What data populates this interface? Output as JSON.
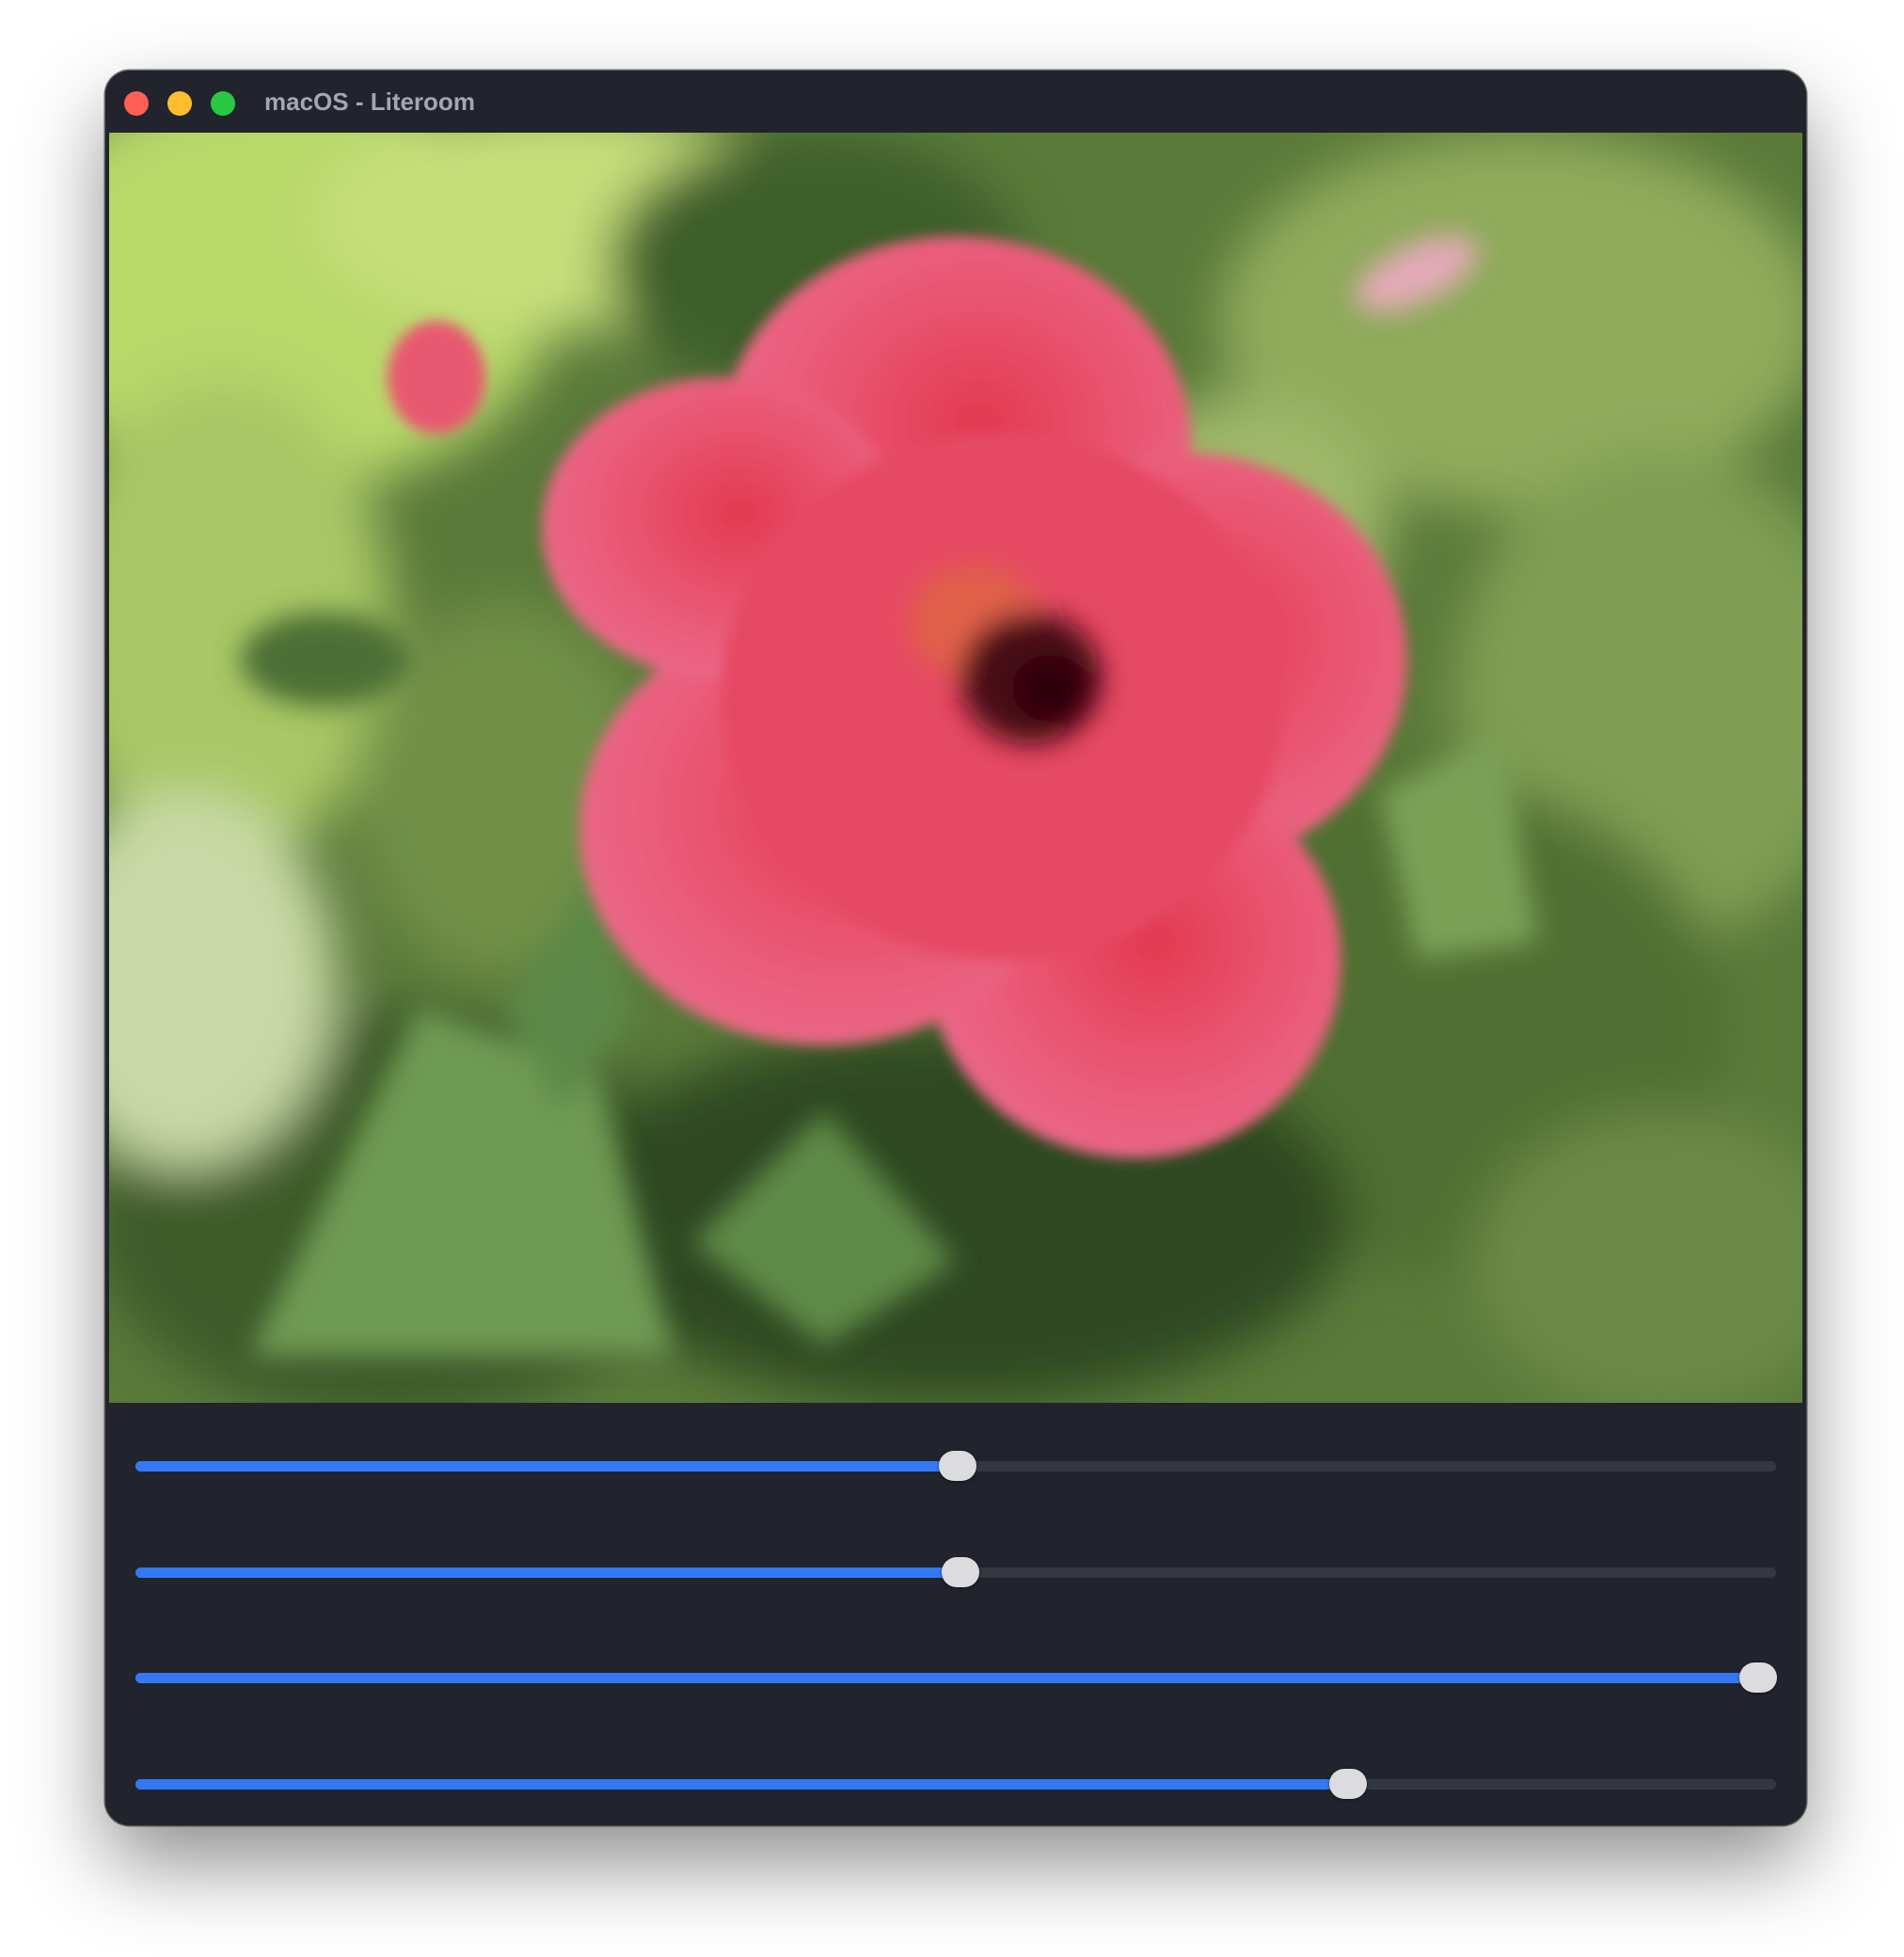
{
  "window": {
    "title": "macOS - Literoom",
    "traffic_lights": [
      {
        "name": "close",
        "color": "#fe5f57"
      },
      {
        "name": "minimize",
        "color": "#febc2e"
      },
      {
        "name": "zoom",
        "color": "#28c840"
      }
    ]
  },
  "photo": {
    "subject_icon": "hibiscus-flower-photo",
    "colors": {
      "petal": "#e9546f",
      "center": "#4a0a14",
      "foliage": "#5f7d3f"
    }
  },
  "sliders": [
    {
      "value": 0.501
    },
    {
      "value": 0.503
    },
    {
      "value": 0.989
    },
    {
      "value": 0.739
    }
  ],
  "colors": {
    "accent": "#3478f6",
    "track": "#343841",
    "panel": "#21242c",
    "thumb": "#dcdcdf"
  }
}
